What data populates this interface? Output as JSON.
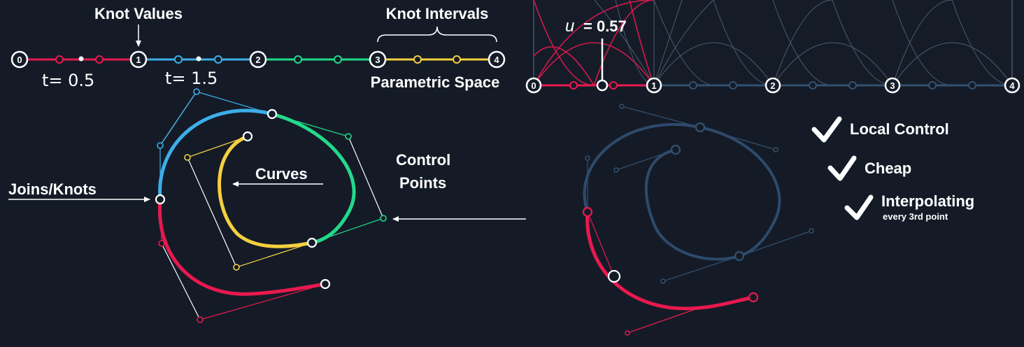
{
  "colors": {
    "background": "#141b27",
    "red": "#e8194f",
    "blue": "#3daee9",
    "green": "#22d98a",
    "yellow": "#f5cf3f",
    "navy": "#2e4a6b",
    "white": "#ffffff"
  },
  "parameter_line": {
    "title": "Knot Values",
    "intervals_label": "Knot Intervals",
    "space_label": "Parametric Space",
    "knots": [
      "0",
      "1",
      "2",
      "3",
      "4"
    ],
    "handwritten": [
      "t= 0.5",
      "t= 1.5"
    ]
  },
  "basis_panel": {
    "u_symbol": "u",
    "u_value": "= 0.57",
    "knots": [
      "0",
      "1",
      "2",
      "3",
      "4"
    ]
  },
  "left_diagram": {
    "joins_label": "Joins/Knots",
    "curves_label": "Curves",
    "control_label_line1": "Control",
    "control_label_line2": "Points"
  },
  "properties": [
    {
      "title": "Local Control",
      "subtitle": ""
    },
    {
      "title": "Cheap",
      "subtitle": ""
    },
    {
      "title": "Interpolating",
      "subtitle": "every 3rd point"
    }
  ]
}
